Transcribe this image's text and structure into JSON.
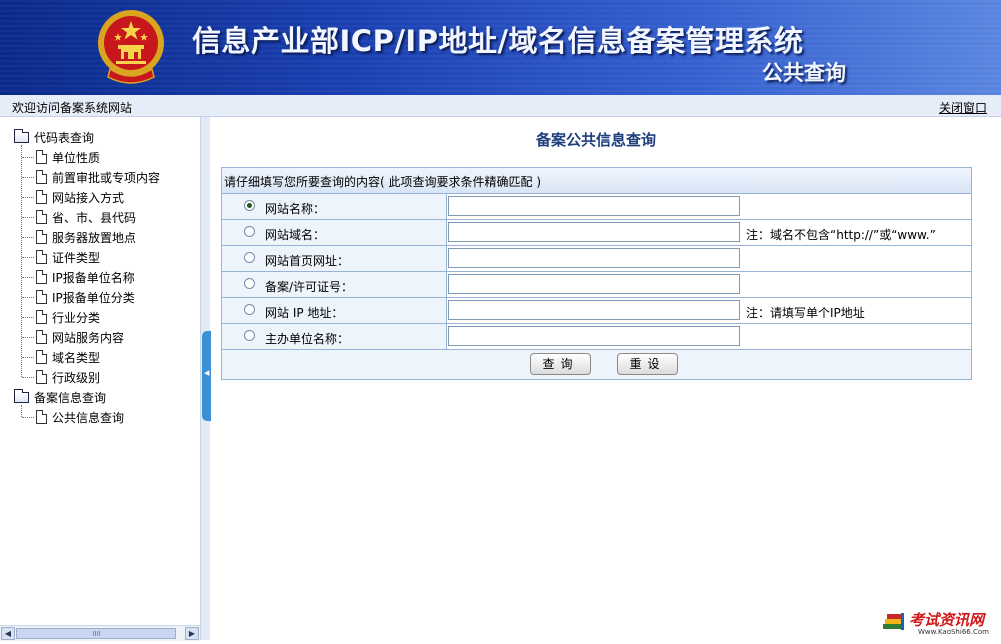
{
  "header": {
    "title": "信息产业部ICP/IP地址/域名信息备案管理系统",
    "subtitle": "公共查询"
  },
  "statusbar": {
    "welcome": "欢迎访问备案系统网站",
    "close": "关闭窗口"
  },
  "tree": {
    "groups": [
      {
        "label": "代码表查询",
        "items": [
          "单位性质",
          "前置审批或专项内容",
          "网站接入方式",
          "省、市、县代码",
          "服务器放置地点",
          "证件类型",
          "IP报备单位名称",
          "IP报备单位分类",
          "行业分类",
          "网站服务内容",
          "域名类型",
          "行政级别"
        ]
      },
      {
        "label": "备案信息查询",
        "items": [
          "公共信息查询"
        ]
      }
    ]
  },
  "main": {
    "title": "备案公共信息查询",
    "instruction": "请仔细填写您所要查询的内容( 此项查询要求条件精确匹配 )",
    "rows": [
      {
        "label": "网站名称：",
        "value": "",
        "note": "",
        "checked": true
      },
      {
        "label": "网站域名：",
        "value": "",
        "note": "注：域名不包含“http://”或“www.”",
        "checked": false
      },
      {
        "label": "网站首页网址：",
        "value": "",
        "note": "",
        "checked": false
      },
      {
        "label": "备案/许可证号：",
        "value": "",
        "note": "",
        "checked": false
      },
      {
        "label": "网站 IP 地址：",
        "value": "",
        "note": "注：请填写单个IP地址",
        "checked": false
      },
      {
        "label": "主办单位名称：",
        "value": "",
        "note": "",
        "checked": false
      }
    ],
    "buttons": {
      "query": "查询",
      "reset": "重设"
    }
  },
  "watermark": {
    "title": "考试资讯网",
    "url": "Www.KaoShi66.Com"
  },
  "colors": {
    "banner": "#1a3fb0",
    "title_blue": "#1f3f7d",
    "border": "#98b3d8",
    "row_bg": "#eef4fb",
    "splitter_handle": "#3d8fd6",
    "watermark_red": "#d21919"
  }
}
